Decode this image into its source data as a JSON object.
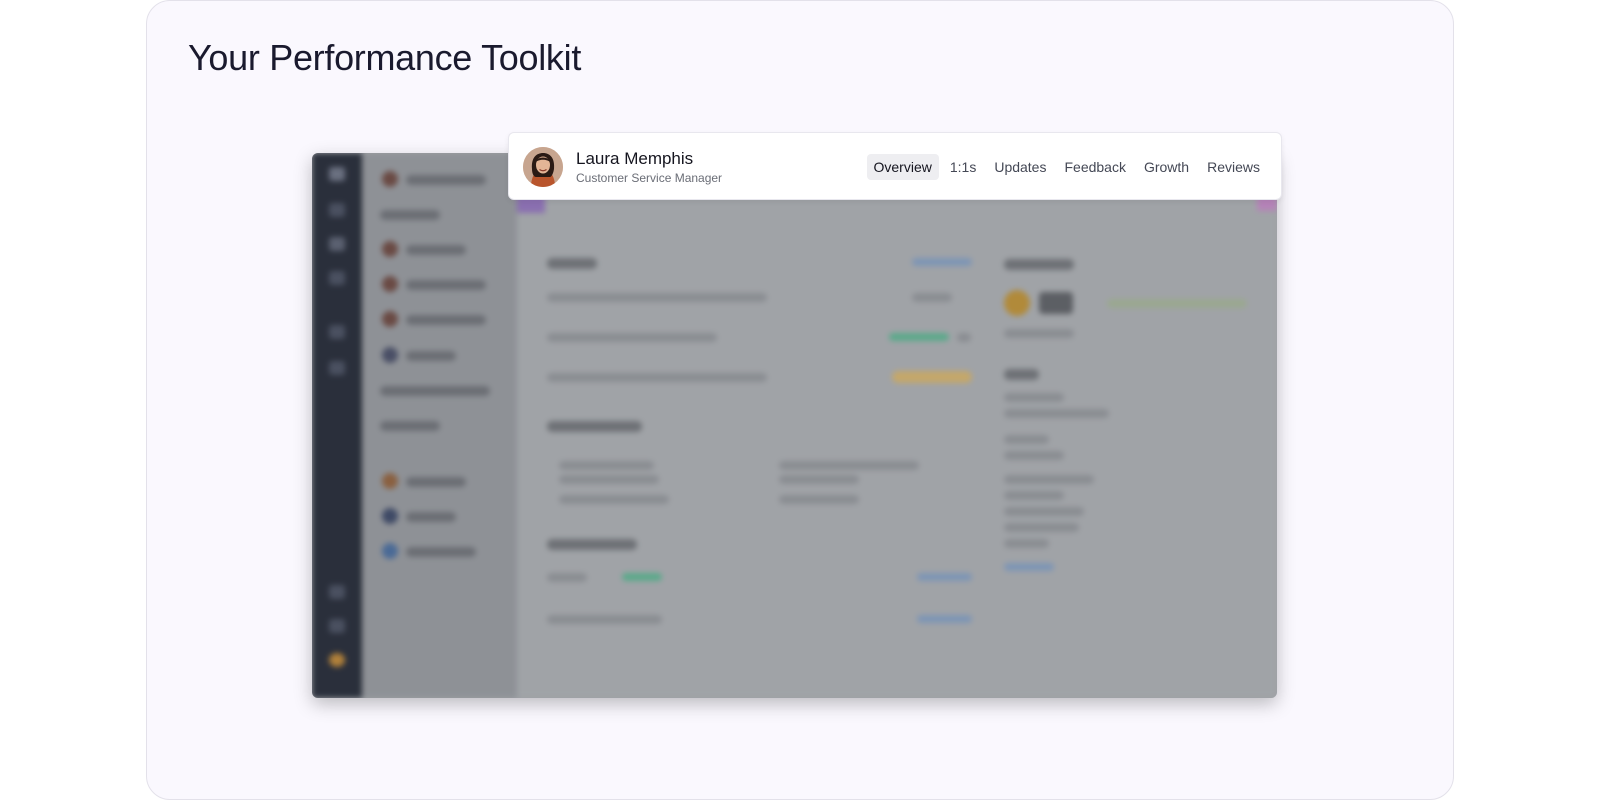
{
  "page": {
    "title": "Your Performance Toolkit"
  },
  "profile": {
    "name": "Laura Memphis",
    "role": "Customer Service Manager",
    "tabs": [
      {
        "label": "Overview",
        "active": true
      },
      {
        "label": "1:1s",
        "active": false
      },
      {
        "label": "Updates",
        "active": false
      },
      {
        "label": "Feedback",
        "active": false
      },
      {
        "label": "Growth",
        "active": false
      },
      {
        "label": "Reviews",
        "active": false
      }
    ]
  },
  "colors": {
    "card_bg": "#faf8fe",
    "active_tab_bg": "#eeeef1",
    "text_primary": "#15151f"
  }
}
